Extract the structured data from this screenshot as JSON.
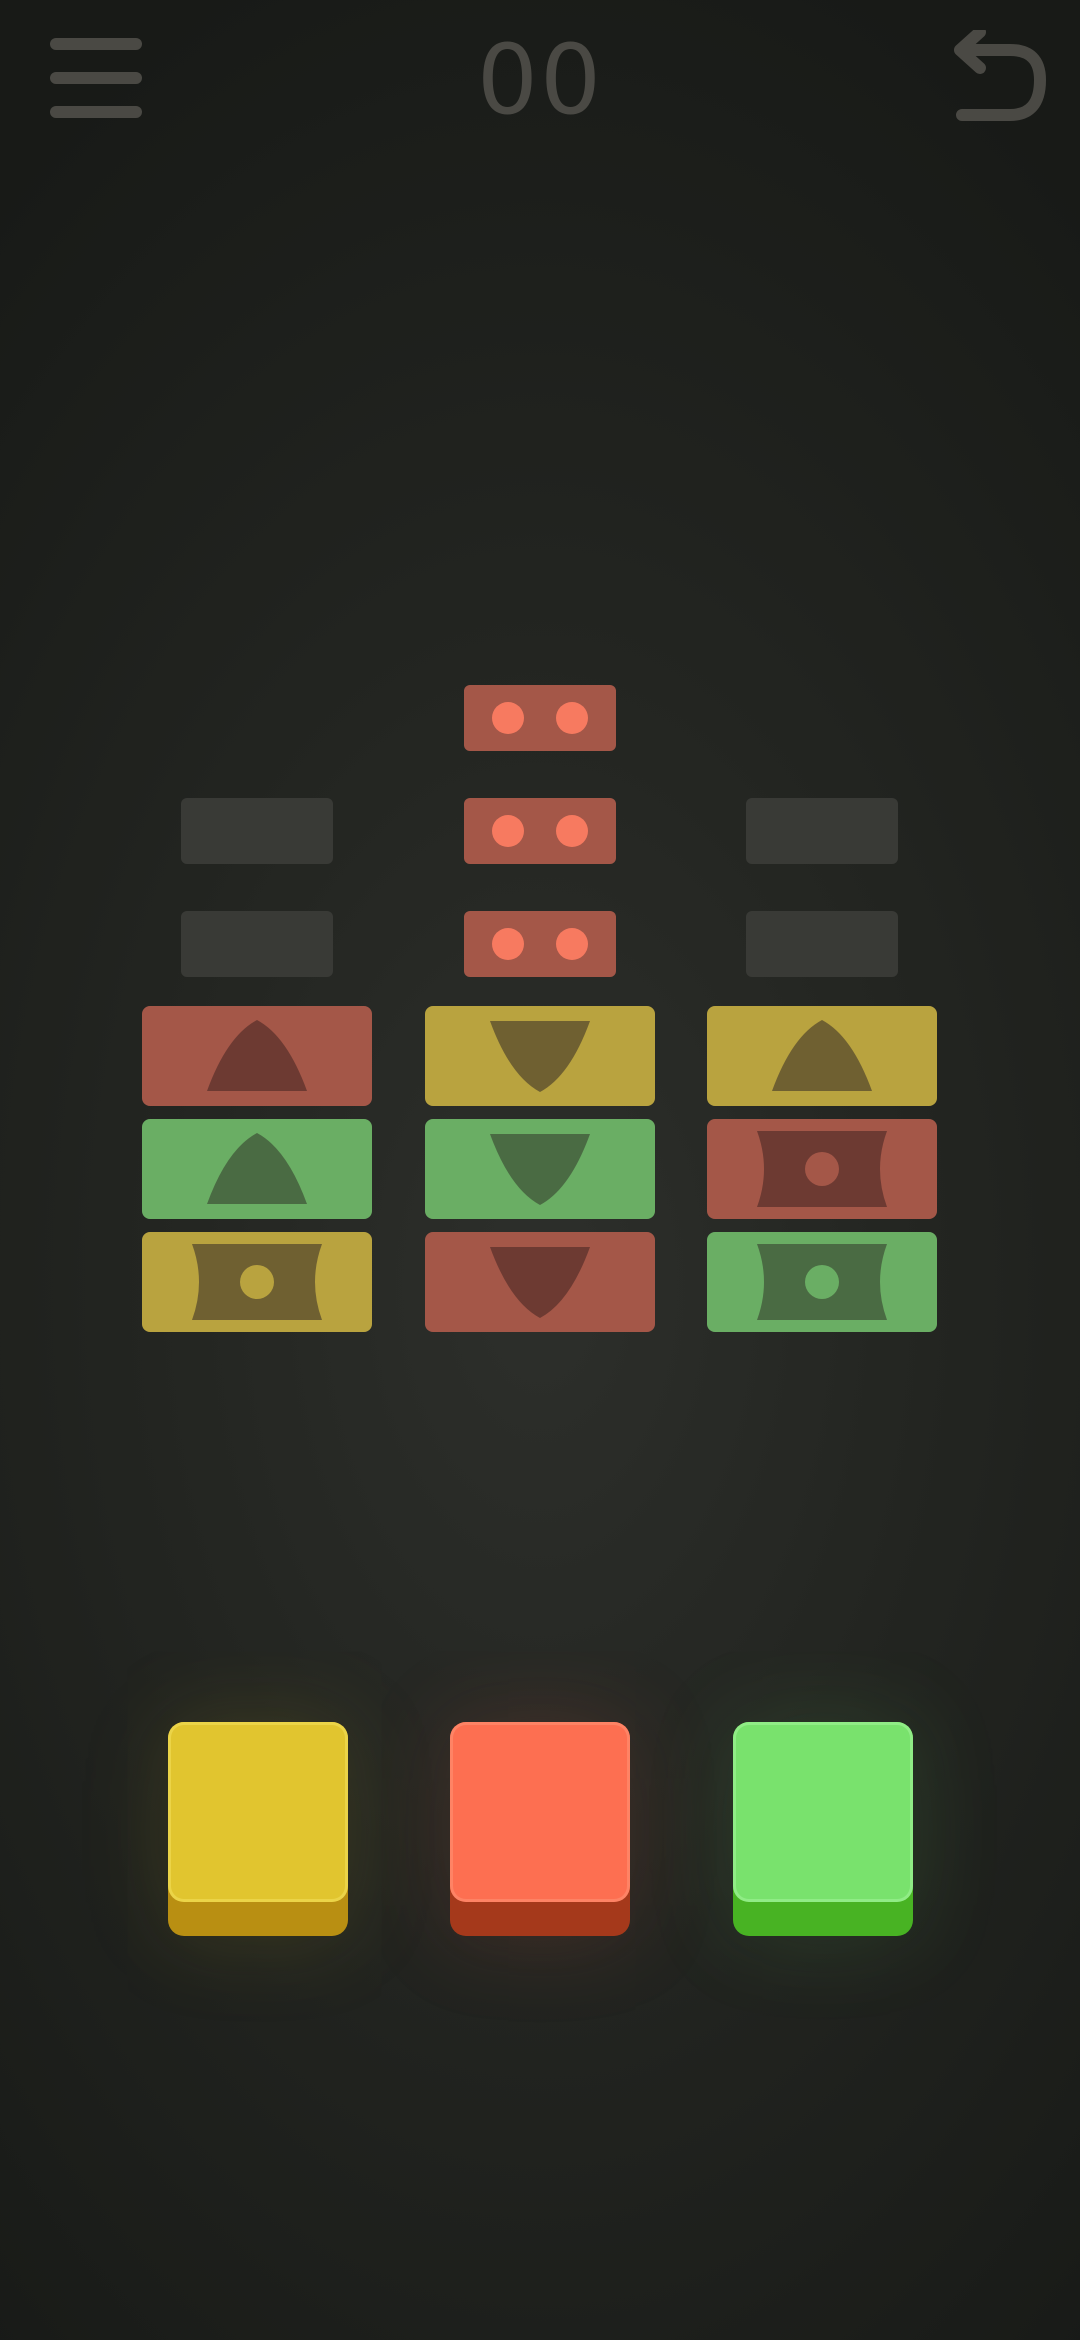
{
  "header": {
    "score": "00",
    "menu_icon": "hamburger-menu-icon",
    "undo_icon": "undo-arrow-icon"
  },
  "colors": {
    "background": "#1f211e",
    "empty_slot": "#393a36",
    "red": "#fd6f51",
    "yellow": "#e1c52f",
    "green": "#79e26d"
  },
  "queue": [
    {
      "color": "red",
      "pips": 2
    },
    {
      "color": "red",
      "pips": 2
    },
    {
      "color": "red",
      "pips": 2
    }
  ],
  "columns": [
    {
      "slots": [
        "empty",
        "empty"
      ],
      "tiles": [
        {
          "color": "red",
          "symbol": "triangle-up"
        },
        {
          "color": "green",
          "symbol": "triangle-up"
        },
        {
          "color": "yellow",
          "symbol": "drum-dot"
        }
      ]
    },
    {
      "slots": [],
      "tiles": [
        {
          "color": "yellow",
          "symbol": "triangle-down"
        },
        {
          "color": "green",
          "symbol": "triangle-down"
        },
        {
          "color": "red",
          "symbol": "triangle-down"
        }
      ]
    },
    {
      "slots": [
        "empty",
        "empty"
      ],
      "tiles": [
        {
          "color": "yellow",
          "symbol": "triangle-up"
        },
        {
          "color": "red",
          "symbol": "drum-dot"
        },
        {
          "color": "green",
          "symbol": "drum-dot"
        }
      ]
    }
  ],
  "color_buttons": [
    {
      "color": "yellow"
    },
    {
      "color": "red"
    },
    {
      "color": "green"
    }
  ]
}
